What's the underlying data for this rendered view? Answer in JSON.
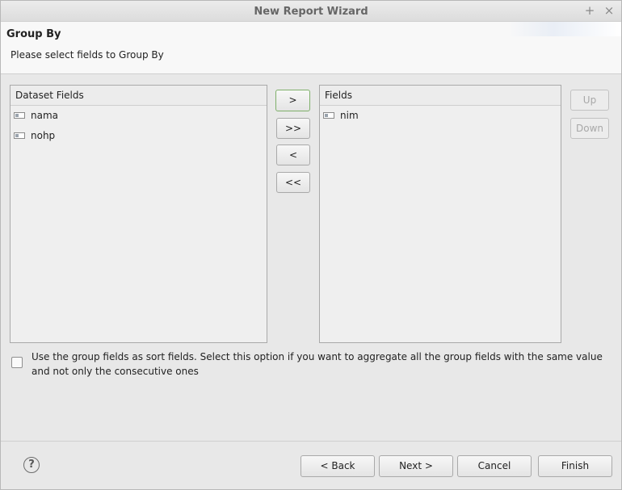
{
  "window": {
    "title": "New Report Wizard",
    "maximize_glyph": "+",
    "close_glyph": "×"
  },
  "header": {
    "heading": "Group By",
    "description": "Please select fields to Group By"
  },
  "dataset_panel": {
    "title": "Dataset Fields",
    "items": [
      "nama",
      "nohp"
    ]
  },
  "fields_panel": {
    "title": "Fields",
    "items": [
      "nim"
    ]
  },
  "transfer_buttons": {
    "add": ">",
    "add_all": ">>",
    "remove": "<",
    "remove_all": "<<"
  },
  "order_buttons": {
    "up": "Up",
    "down": "Down"
  },
  "sort_option": {
    "label": "Use the group fields as sort fields. Select this option if you want to aggregate all the group fields with the same value and not only the consecutive ones",
    "checked": false
  },
  "footer": {
    "back": "< Back",
    "next": "Next >",
    "cancel": "Cancel",
    "finish": "Finish",
    "help_glyph": "?"
  }
}
